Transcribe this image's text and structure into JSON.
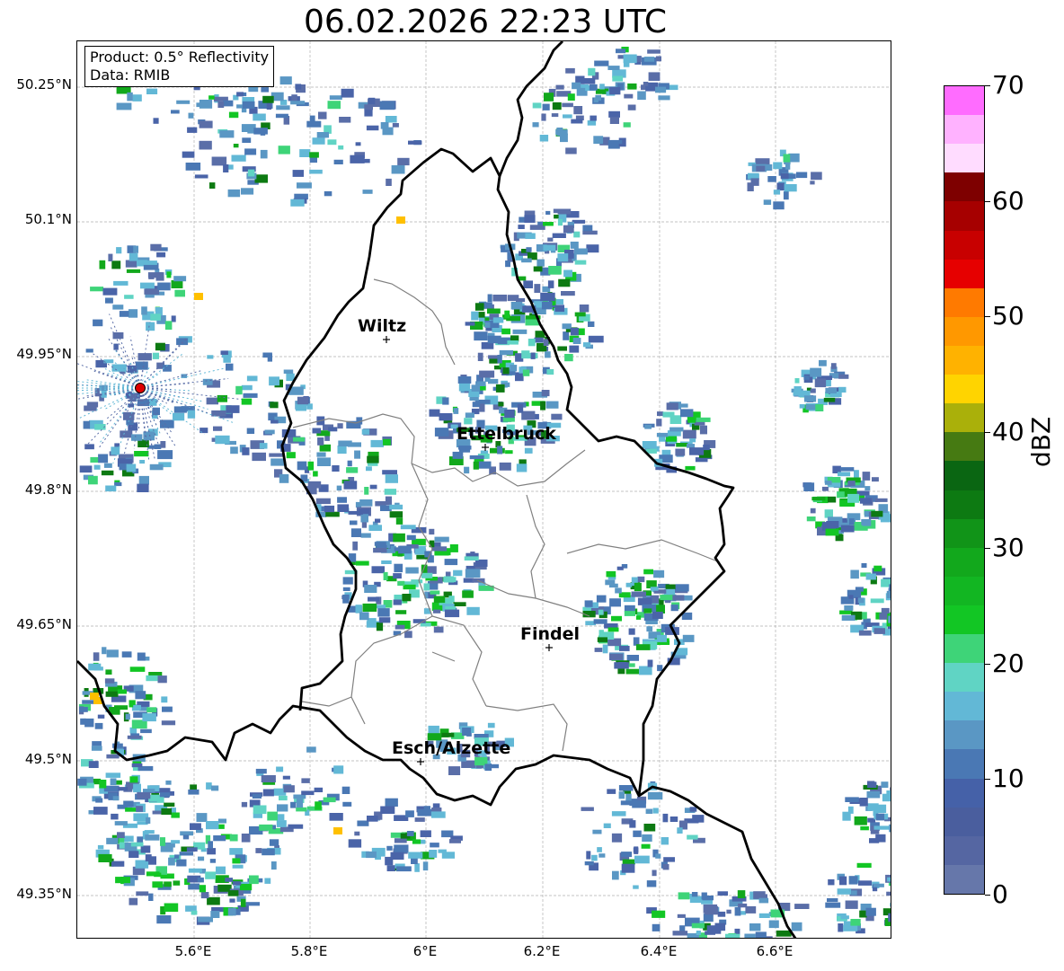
{
  "title": "06.02.2026 22:23 UTC",
  "info": {
    "product": "Product: 0.5° Reflectivity",
    "data": "Data: RMIB"
  },
  "axes": {
    "lat_labels": [
      "50.25°N",
      "50.1°N",
      "49.95°N",
      "49.8°N",
      "49.65°N",
      "49.5°N",
      "49.35°N"
    ],
    "lon_labels": [
      "5.6°E",
      "5.8°E",
      "6°E",
      "6.2°E",
      "6.4°E",
      "6.6°E"
    ]
  },
  "cities": [
    {
      "name": "Wiltz"
    },
    {
      "name": "Ettelbruck"
    },
    {
      "name": "Findel"
    },
    {
      "name": "Esch/Alzette"
    }
  ],
  "colorbar": {
    "label": "dBZ",
    "ticks": [
      "0",
      "10",
      "20",
      "30",
      "40",
      "50",
      "60",
      "70"
    ],
    "min": 0,
    "max": 70,
    "step": 2.5,
    "colors": [
      "#6677aa",
      "#5566a2",
      "#4a5e9e",
      "#4561a8",
      "#4a78b4",
      "#5a97c4",
      "#62b8d6",
      "#60d4c4",
      "#3ed478",
      "#12c624",
      "#12b622",
      "#12a81c",
      "#119418",
      "#0d7a12",
      "#0a6612",
      "#467a12",
      "#aab00a",
      "#ffd400",
      "#ffb200",
      "#ff9800",
      "#ff7a00",
      "#e60000",
      "#c80000",
      "#a60000",
      "#7e0000",
      "#ffdcff",
      "#ffb2ff",
      "#ff6cff",
      "#ee3cee"
    ]
  }
}
